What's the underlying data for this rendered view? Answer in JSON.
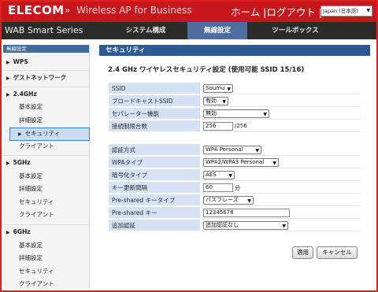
{
  "header": {
    "logo": "ELECOM",
    "separator": "»",
    "tagline": "Wireless AP for Business",
    "home": "ホーム",
    "divider": "|",
    "logout": "ログアウト",
    "divider2": "|",
    "language": "Japan (日本語)"
  },
  "navbar": {
    "series": "WAB Smart Series",
    "tabs": [
      "システム構成",
      "無線設定",
      "ツールボックス"
    ],
    "active_tab": "無線設定"
  },
  "sidebar": {
    "header": "無線設定",
    "items": [
      {
        "label": "WPS",
        "type": "section"
      },
      {
        "label": "ゲストネットワーク",
        "type": "section"
      },
      {
        "label": "2.4GHz",
        "type": "section"
      },
      {
        "label": "基本設定",
        "type": "sub"
      },
      {
        "label": "詳細設定",
        "type": "sub"
      },
      {
        "label": "セキュリティ",
        "type": "selected"
      },
      {
        "label": "クライアント",
        "type": "sub"
      },
      {
        "label": "5GHz",
        "type": "section"
      },
      {
        "label": "基本設定",
        "type": "sub"
      },
      {
        "label": "詳細設定",
        "type": "sub"
      },
      {
        "label": "セキュリティ",
        "type": "sub"
      },
      {
        "label": "クライアント",
        "type": "sub"
      },
      {
        "label": "6GHz",
        "type": "section"
      },
      {
        "label": "基本設定",
        "type": "sub"
      },
      {
        "label": "詳細設定",
        "type": "sub"
      },
      {
        "label": "セキュリティ",
        "type": "sub"
      },
      {
        "label": "クライアント",
        "type": "sub"
      }
    ]
  },
  "main": {
    "title": "セキュリティ",
    "section_title": "2.4 GHz ワイヤレスセキュリティ設定 (使用可能 SSID 15/16)",
    "group1": [
      {
        "label": "SSID",
        "value": "Soumu",
        "kind": "select"
      },
      {
        "label": "ブロードキャストSSID",
        "value": "有効",
        "kind": "select"
      },
      {
        "label": "セパレーター機能",
        "value": "無効",
        "kind": "select"
      },
      {
        "label": "接続制限台数",
        "value": "256",
        "kind": "input",
        "suffix": "/256"
      }
    ],
    "group2": [
      {
        "label": "認証方式",
        "value": "WPA Personal",
        "kind": "select"
      },
      {
        "label": "WPAタイプ",
        "value": "WPA2/WPA3 Personal",
        "kind": "select"
      },
      {
        "label": "暗号化タイプ",
        "value": "AES",
        "kind": "select"
      },
      {
        "label": "キー更新間隔",
        "value": "60",
        "kind": "input",
        "suffix": "分"
      },
      {
        "label": "Pre-shared キータイプ",
        "value": "パスフレーズ",
        "kind": "select"
      },
      {
        "label": "Pre-shared キー",
        "value": "12345678",
        "kind": "input"
      },
      {
        "label": "追加認証",
        "value": "追加認証なし",
        "kind": "select"
      }
    ],
    "apply_button": "適用",
    "cancel_button": "キャンセル"
  },
  "colors": {
    "brand_red": "#c8161d",
    "nav_dark": "#2b2b2b",
    "active_tab": "#4d6e9c",
    "label_bg": "#d4e2f4",
    "title_bar": "#2d5a92"
  }
}
